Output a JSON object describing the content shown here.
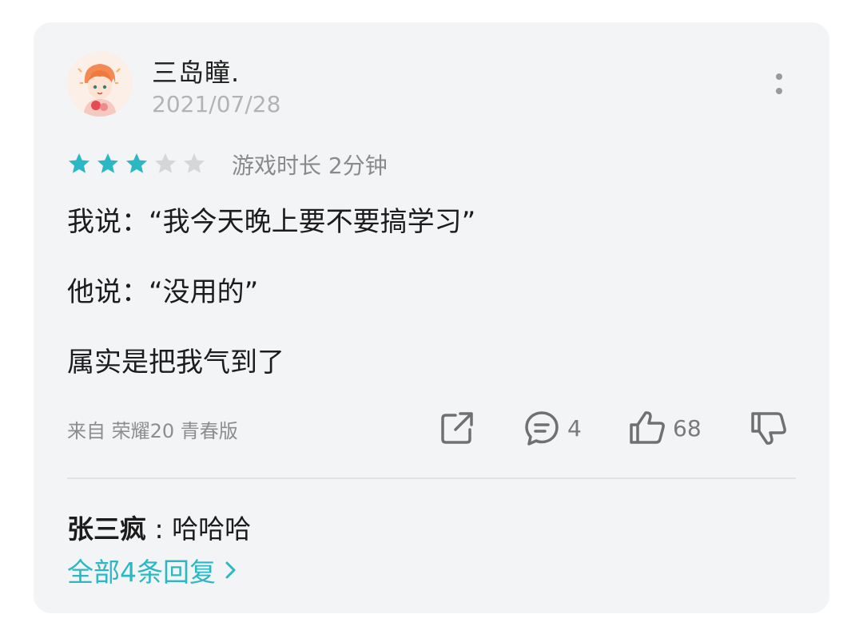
{
  "review": {
    "username": "三岛瞳.",
    "date": "2021/07/28",
    "rating": 3,
    "max_rating": 5,
    "playtime": "游戏时长 2分钟",
    "lines": [
      "我说：“我今天晚上要不要搞学习”",
      "他说：“没用的”",
      "属实是把我气到了"
    ],
    "device": "来自 荣耀20 青春版",
    "comment_count": "4",
    "like_count": "68"
  },
  "reply_preview": {
    "name": "张三疯",
    "separator": " : ",
    "text": "哈哈哈"
  },
  "all_replies_label": "全部4条回复",
  "colors": {
    "accent": "#2bb7c4",
    "star_on": "#2bb7c4",
    "star_off": "#d6d6d6",
    "icon": "#707070"
  },
  "icons": {
    "more": "more-vertical-icon",
    "share": "share-external-icon",
    "comment": "comment-bubble-icon",
    "like": "thumbs-up-icon",
    "dislike": "thumbs-down-icon",
    "chevron": "chevron-right-icon"
  }
}
